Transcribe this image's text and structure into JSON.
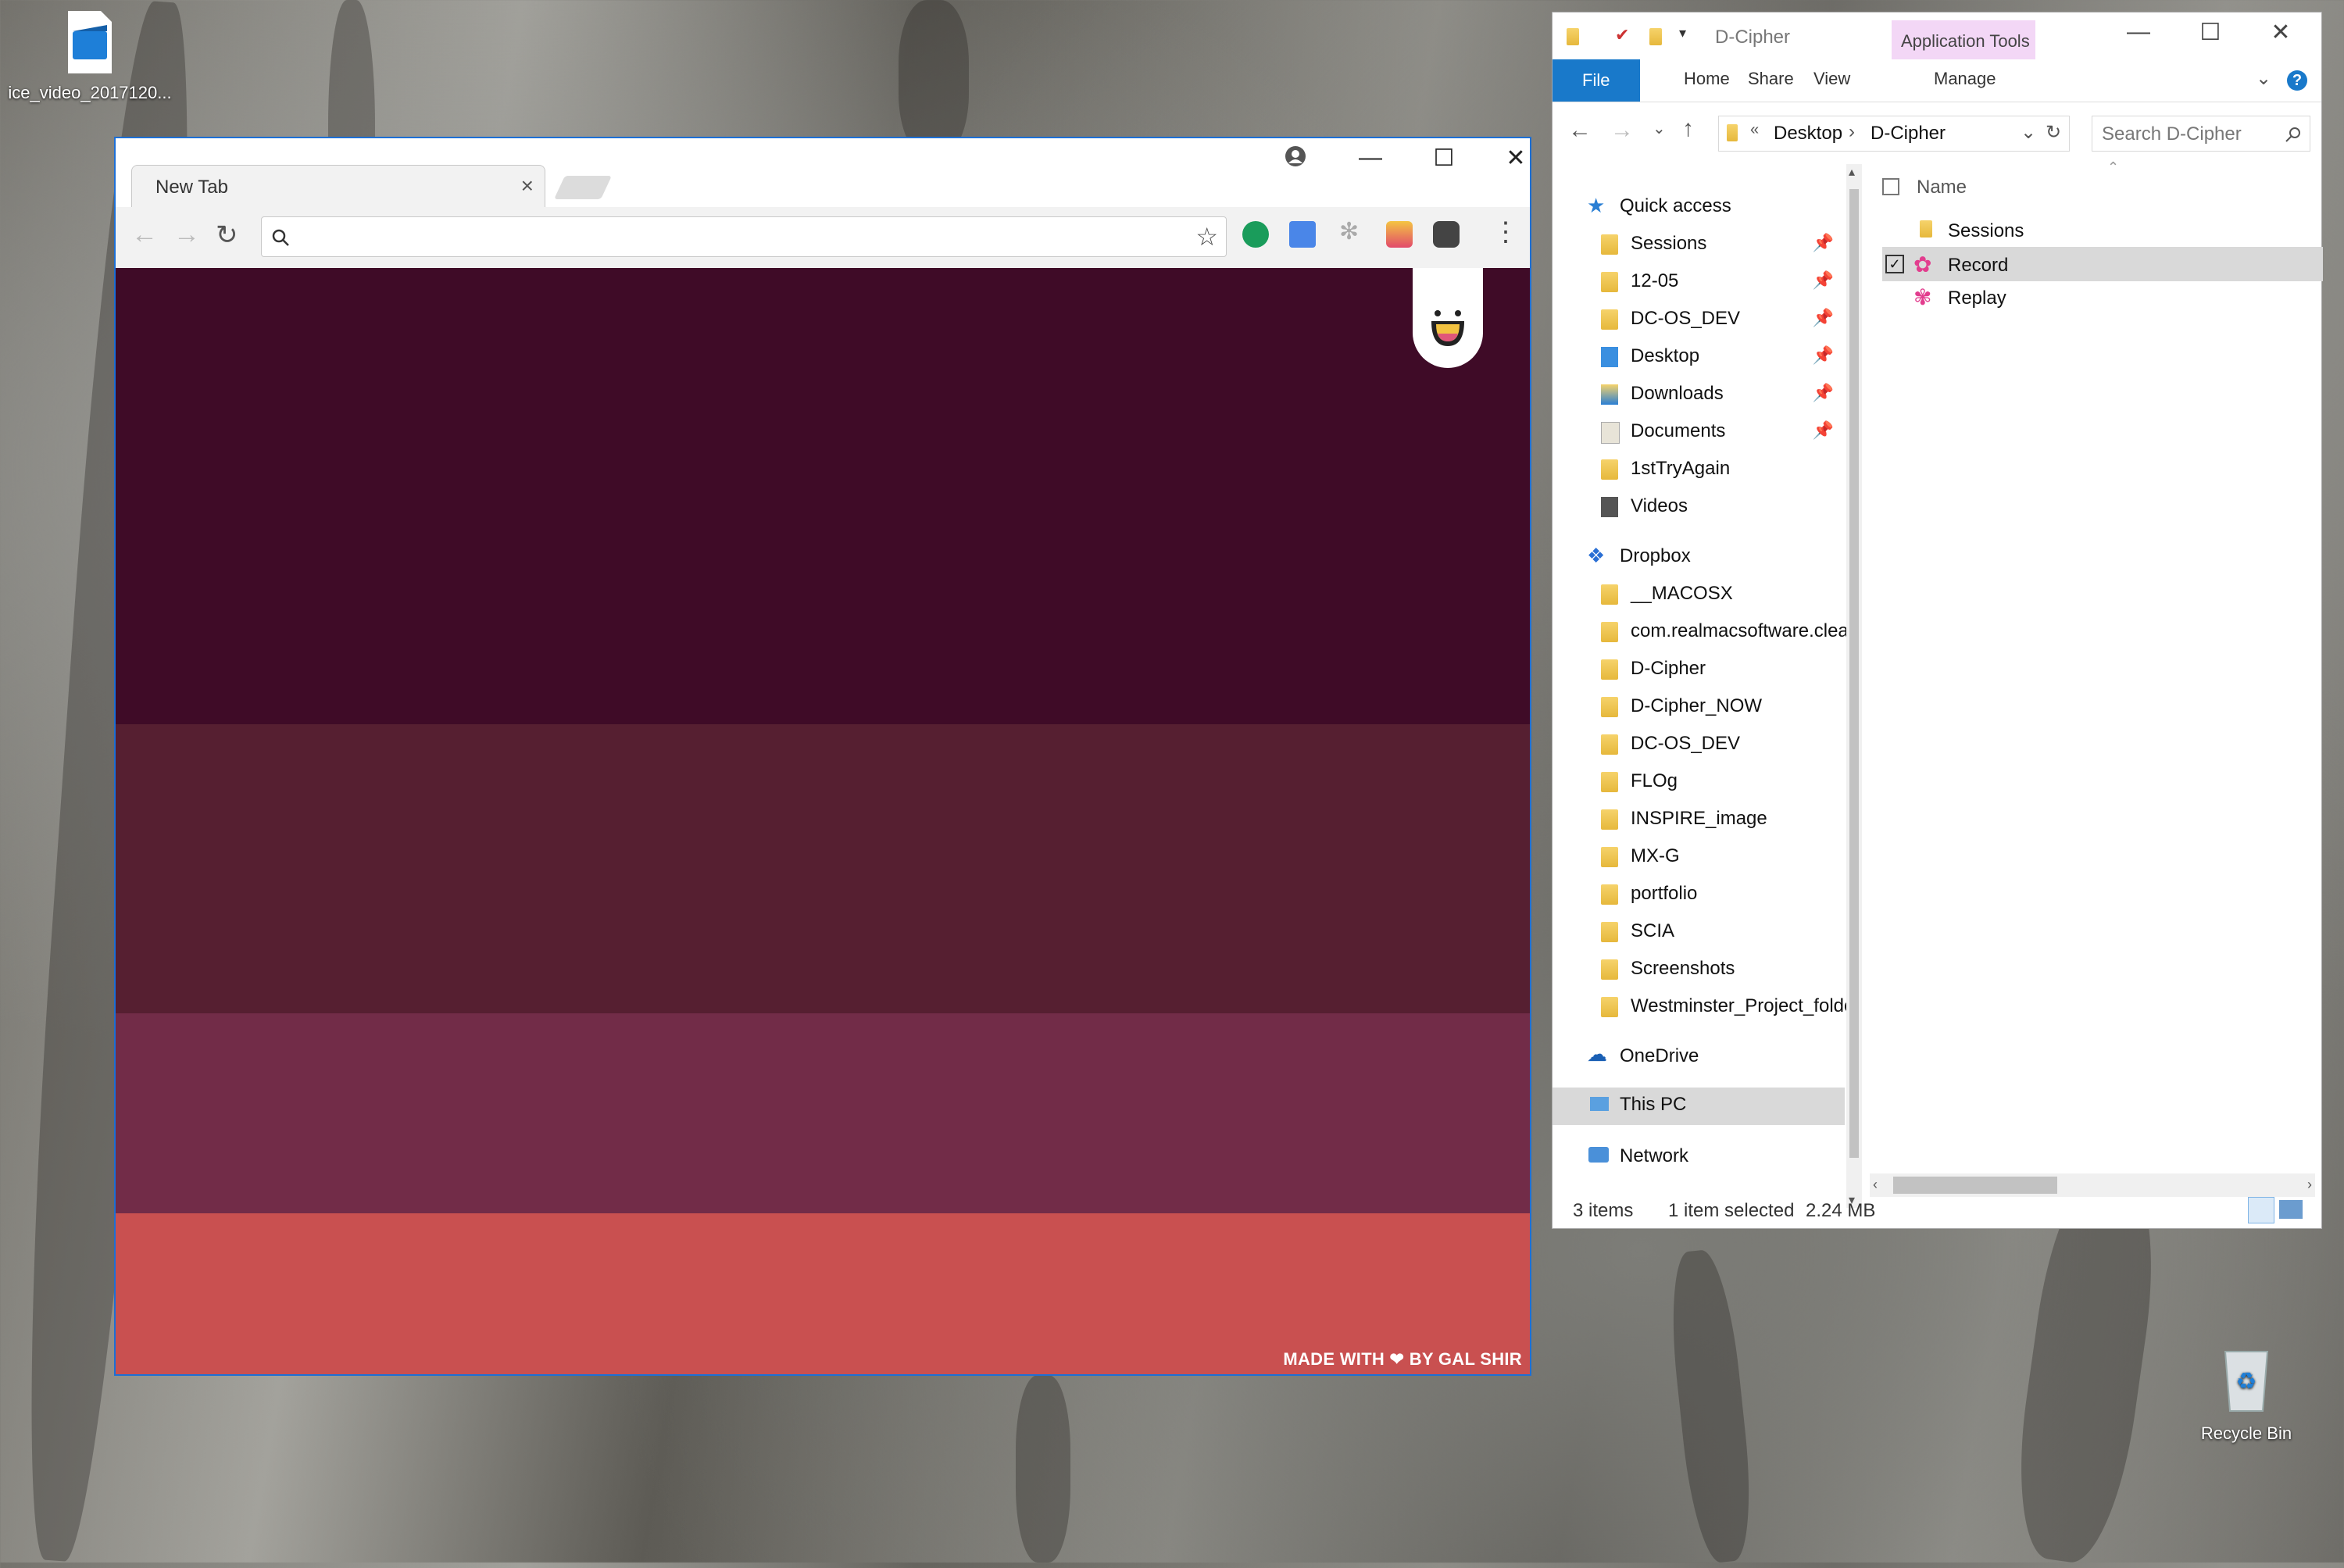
{
  "desktop": {
    "video_icon_label": "ice_video_2017120...",
    "recycle_bin_label": "Recycle Bin"
  },
  "chrome": {
    "tab_title": "New Tab",
    "omnibox_value": "",
    "bands": [
      "#3f0b27",
      "#561f31",
      "#722c48",
      "#c95050"
    ],
    "credit_prefix": "MADE WITH",
    "credit_heart": "❤",
    "credit_suffix": "BY GAL SHIR"
  },
  "explorer": {
    "title": "D-Cipher",
    "context_tab": "Application Tools",
    "ribbon_tabs": [
      "File",
      "Home",
      "Share",
      "View",
      "Manage"
    ],
    "breadcrumb": [
      "Desktop",
      "D-Cipher"
    ],
    "search_placeholder": "Search D-Cipher",
    "column_name": "Name",
    "quick_access_label": "Quick access",
    "quick_access_items": [
      "Sessions",
      "12-05",
      "DC-OS_DEV",
      "Desktop",
      "Downloads",
      "Documents",
      "1stTryAgain",
      "Videos"
    ],
    "dropbox_label": "Dropbox",
    "dropbox_items": [
      "__MACOSX",
      "com.realmacsoftware.clea",
      "D-Cipher",
      "D-Cipher_NOW",
      "DC-OS_DEV",
      "FLOg",
      "INSPIRE_image",
      "MX-G",
      "portfolio",
      "SCIA",
      "Screenshots",
      "Westminster_Project_folde"
    ],
    "onedrive_label": "OneDrive",
    "thispc_label": "This PC",
    "network_label": "Network",
    "files": [
      "Sessions",
      "Record",
      "Replay"
    ],
    "status_items": "3 items",
    "status_selected": "1 item selected",
    "status_size": "2.24 MB"
  }
}
